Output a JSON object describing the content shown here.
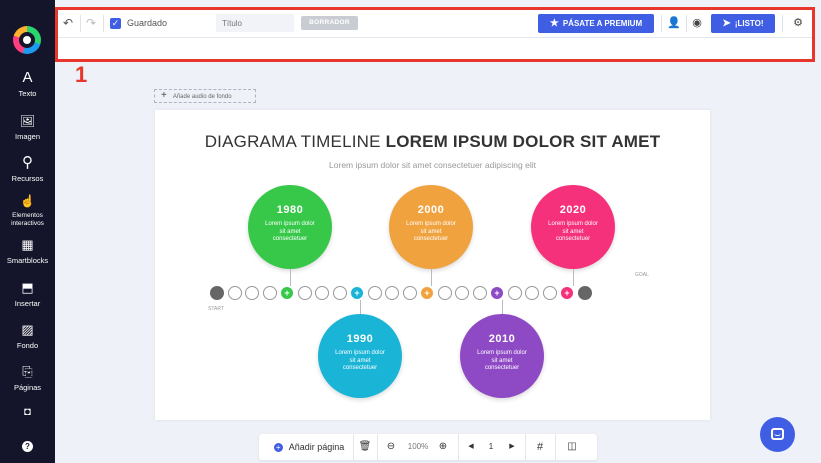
{
  "sidebar": {
    "items": [
      {
        "label": "Texto",
        "icon": "A"
      },
      {
        "label": "Imagen",
        "icon": "🖼"
      },
      {
        "label": "Recursos",
        "icon": "⚲"
      },
      {
        "label": "Elementos interactivos",
        "icon": "☝"
      },
      {
        "label": "Smartblocks",
        "icon": "▦"
      },
      {
        "label": "Insertar",
        "icon": "⬒"
      },
      {
        "label": "Fondo",
        "icon": "▨"
      },
      {
        "label": "Páginas",
        "icon": "⎘"
      }
    ]
  },
  "toolbar": {
    "saved_label": "Guardado",
    "title_placeholder": "Título",
    "draft_label": "BORRADOR",
    "premium_label": "PÁSATE A PREMIUM",
    "ready_label": "¡LISTO!"
  },
  "annotation_number": "1",
  "audio_label": "Añade audio de fondo",
  "canvas": {
    "title_light": "DIAGRAMA TIMELINE",
    "title_bold": "LOREM IPSUM DOLOR SIT AMET",
    "subtitle": "Lorem ipsum dolor sit amet consectetuer adipiscing elit",
    "start_label": "START",
    "goal_label": "GOAL",
    "milestones": [
      {
        "year": "1980",
        "text": "Lorem ipsum dolor sit amet consectetuer",
        "color": "#37c84a"
      },
      {
        "year": "1990",
        "text": "Lorem ipsum dolor sit amet consectetuer",
        "color": "#1ab4d6"
      },
      {
        "year": "2000",
        "text": "Lorem ipsum dolor sit amet consectetuer",
        "color": "#f0a23f"
      },
      {
        "year": "2010",
        "text": "Lorem ipsum dolor sit amet consectetuer",
        "color": "#8e49c5"
      },
      {
        "year": "2020",
        "text": "Lorem ipsum dolor sit amet consectetuer",
        "color": "#f4317a"
      }
    ]
  },
  "bottombar": {
    "add_page_label": "Añadir página",
    "zoom": "100%",
    "page_number": "1"
  },
  "colors": {
    "accent": "#3f5ee3",
    "sidebar_bg": "#14152a",
    "highlight": "#e8362c"
  }
}
